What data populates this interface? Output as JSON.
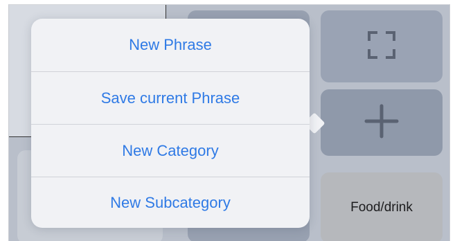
{
  "menu": {
    "items": [
      {
        "label": "New Phrase"
      },
      {
        "label": "Save current Phrase"
      },
      {
        "label": "New Category"
      },
      {
        "label": "New Subcategory"
      }
    ]
  },
  "tiles": {
    "food_label": "Food/drink",
    "fullscreen_icon": "fullscreen-icon",
    "add_icon": "plus-icon"
  },
  "colors": {
    "accent": "#2f7ae5",
    "popover_bg": "#f1f2f5",
    "tile_bg": "#9aa3b4"
  }
}
